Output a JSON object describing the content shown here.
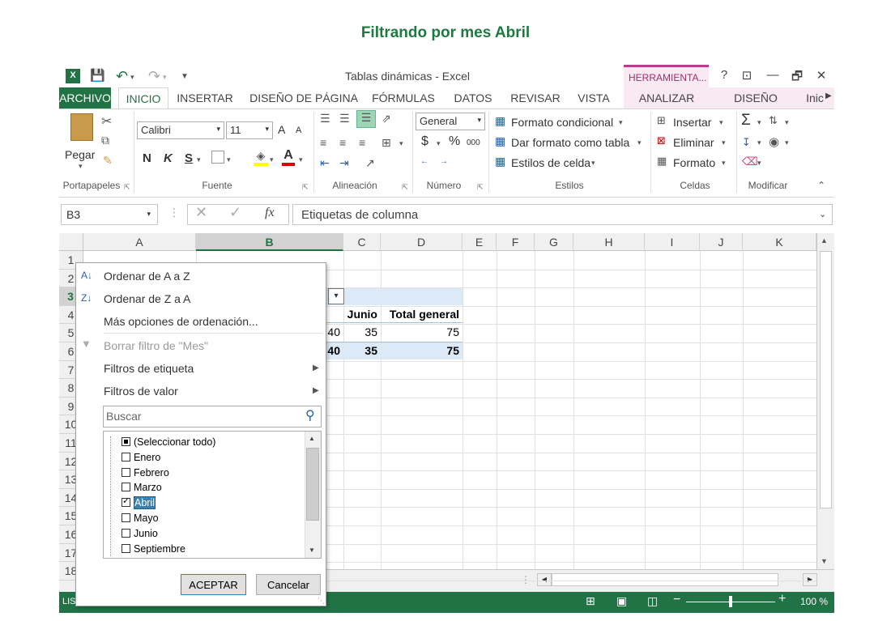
{
  "caption": "Filtrando por mes Abril",
  "window": {
    "title": "Tablas dinámicas - Excel",
    "context_tab": "HERRAMIENTA...",
    "help": "?",
    "controls": [
      "⊡",
      "—",
      "🗗",
      "✕"
    ]
  },
  "tabs": {
    "items": [
      "ARCHIVO",
      "INICIO",
      "INSERTAR",
      "DISEÑO DE PÁGINA",
      "FÓRMULAS",
      "DATOS",
      "REVISAR",
      "VISTA",
      "ANALIZAR",
      "DISEÑO",
      "Inic"
    ]
  },
  "ribbon": {
    "clipboard": {
      "paste": "Pegar",
      "label": "Portapapeles"
    },
    "font": {
      "name": "Calibri",
      "size": "11",
      "bold": "N",
      "italic": "K",
      "underline": "S",
      "color_a": "A",
      "label": "Fuente",
      "grow": "A",
      "shrink": "A"
    },
    "alignment": {
      "label": "Alineación"
    },
    "number": {
      "format": "General",
      "currency": "$",
      "percent": "%",
      "thousands": "000",
      "label": "Número"
    },
    "styles": {
      "cond": "Formato condicional",
      "table": "Dar formato como tabla",
      "cell": "Estilos de celda",
      "label": "Estilos"
    },
    "cells": {
      "insert": "Insertar",
      "delete": "Eliminar",
      "format": "Formato",
      "label": "Celdas"
    },
    "edit": {
      "label": "Modificar",
      "sum": "Σ"
    }
  },
  "formula": {
    "namebox": "B3",
    "fx": "fx",
    "content": "Etiquetas de columna"
  },
  "grid": {
    "columns": [
      "A",
      "B",
      "C",
      "D",
      "E",
      "F",
      "G",
      "H",
      "I",
      "J",
      "K"
    ],
    "rows": [
      "1",
      "2",
      "3",
      "4",
      "5",
      "6",
      "7",
      "8",
      "9",
      "10",
      "11",
      "12",
      "13",
      "14",
      "15",
      "16",
      "17",
      "18"
    ],
    "cells": {
      "c4": "Junio",
      "d4": "Total general",
      "b5": "40",
      "c5": "35",
      "d5": "75",
      "b6": "40",
      "c6": "35",
      "d6": "75"
    }
  },
  "filter_menu": {
    "sort_az": "Ordenar de A a Z",
    "sort_za": "Ordenar de Z a A",
    "more_sort": "Más opciones de ordenación...",
    "clear_filter": "Borrar filtro de \"Mes\"",
    "label_filters": "Filtros de etiqueta",
    "value_filters": "Filtros de valor",
    "search_placeholder": "Buscar",
    "items": [
      {
        "label": "(Seleccionar todo)",
        "state": "partial"
      },
      {
        "label": "Enero",
        "state": "unchecked"
      },
      {
        "label": "Febrero",
        "state": "unchecked"
      },
      {
        "label": "Marzo",
        "state": "unchecked"
      },
      {
        "label": "Abril",
        "state": "checked"
      },
      {
        "label": "Mayo",
        "state": "unchecked"
      },
      {
        "label": "Junio",
        "state": "unchecked"
      },
      {
        "label": "Septiembre",
        "state": "unchecked"
      }
    ],
    "ok": "ACEPTAR",
    "cancel": "Cancelar"
  },
  "status": {
    "mode": "LIS",
    "zoom": "100 %"
  },
  "colors": {
    "excel_green": "#217346",
    "context_pink": "#a1306a",
    "pivot_blue": "#dce9f6"
  }
}
